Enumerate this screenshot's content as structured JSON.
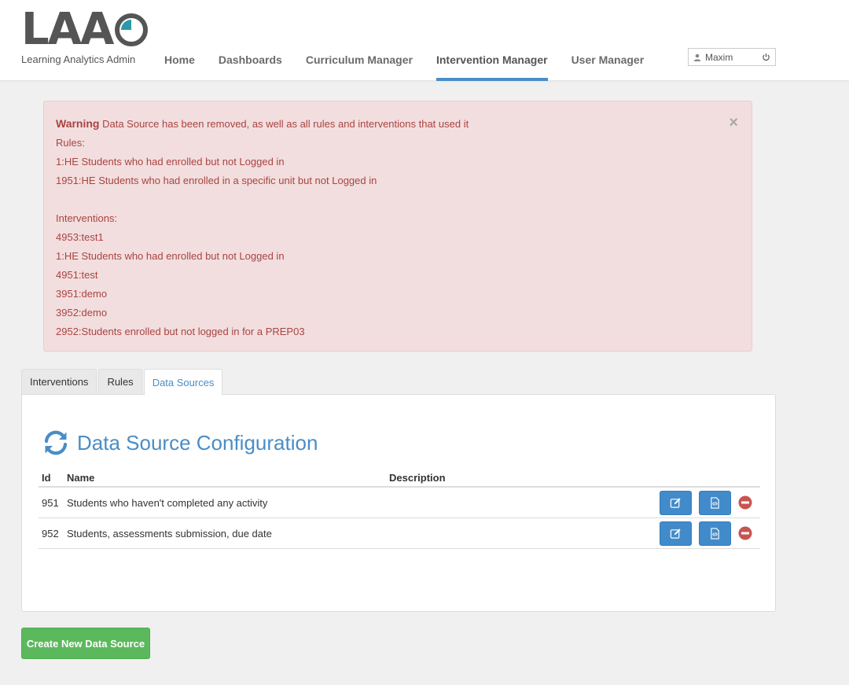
{
  "logo": {
    "text": "LAA",
    "subtitle": "Learning Analytics Admin"
  },
  "nav": {
    "items": [
      {
        "label": "Home"
      },
      {
        "label": "Dashboards"
      },
      {
        "label": "Curriculum Manager"
      },
      {
        "label": "Intervention Manager"
      },
      {
        "label": "User Manager"
      }
    ],
    "active": "Intervention Manager"
  },
  "user": {
    "name": "Maxim",
    "icon": "user-icon",
    "logout_icon": "power-icon"
  },
  "alert": {
    "title": "Warning",
    "message": "Data Source has been removed, as well as all rules and interventions that used it",
    "rules_heading": "Rules:",
    "rules": [
      "1:HE Students who had enrolled but not Logged in",
      "1951:HE Students who had enrolled in a specific unit but not Logged in"
    ],
    "interventions_heading": "Interventions:",
    "interventions": [
      "4953:test1",
      "1:HE Students who had enrolled but not Logged in",
      "4951:test",
      "3951:demo",
      "3952:demo",
      "2952:Students enrolled but not logged in for a PREP03"
    ],
    "close": "×"
  },
  "tabs": [
    {
      "label": "Interventions"
    },
    {
      "label": "Rules"
    },
    {
      "label": "Data Sources"
    }
  ],
  "panel": {
    "title": "Data Source Configuration",
    "icon": "refresh-icon",
    "columns": {
      "id": "Id",
      "name": "Name",
      "description": "Description"
    },
    "rows": [
      {
        "id": "951",
        "name": "Students who haven't completed any activity",
        "description": ""
      },
      {
        "id": "952",
        "name": "Students, assessments submission, due date",
        "description": ""
      }
    ]
  },
  "create_button": "Create New Data Source",
  "colors": {
    "accent": "#4a8dc6",
    "alert_bg": "#f2dede",
    "alert_text": "#a94442",
    "success": "#5cb85c",
    "danger": "#c9534f"
  }
}
